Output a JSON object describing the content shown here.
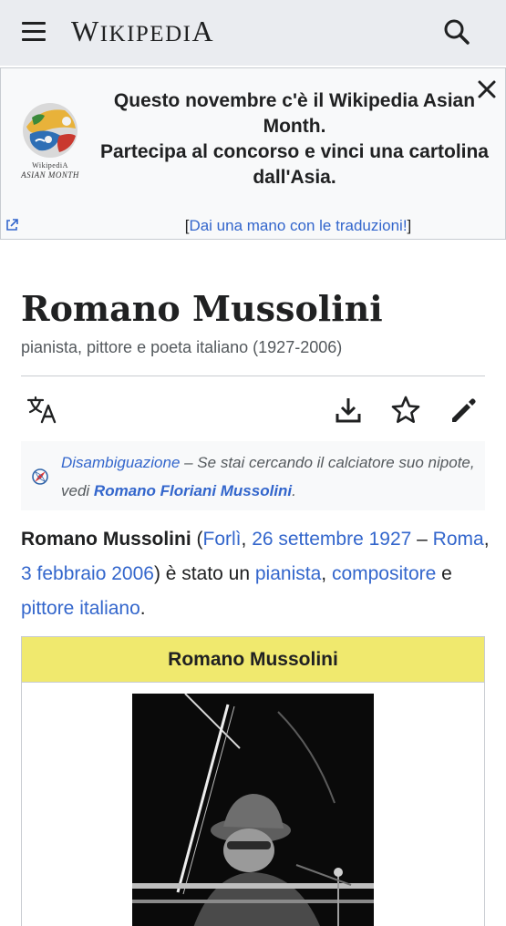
{
  "header": {
    "wordmark_first": "W",
    "wordmark_mid": "IKIPEDI",
    "wordmark_last": "A"
  },
  "banner": {
    "line1": "Questo novembre c'è il Wikipedia Asian Month.",
    "line2": "Partecipa al concorso e vinci una cartolina dall'Asia.",
    "logo_line1": "WikipediA",
    "logo_line2": "ASIAN MONTH",
    "link_open": "[",
    "link_label": "Dai una mano con le traduzioni!",
    "link_close": "]"
  },
  "page": {
    "title": "Romano Mussolini",
    "description": "pianista, pittore e poeta italiano (1927-2006)"
  },
  "hatnote": {
    "link1": "Disambiguazione",
    "text1": " – Se stai cercando il calciatore suo nipote, vedi ",
    "link2": "Romano Floriani Mussolini",
    "text2": "."
  },
  "lead": {
    "subject": "Romano Mussolini",
    "p1": " (",
    "birthplace": "Forlì",
    "p2": ", ",
    "birthdate": "26 settembre 1927",
    "p3": " – ",
    "deathplace": "Roma",
    "p4": ", ",
    "deathdate": "3 febbraio 2006",
    "p5": ") è stato un ",
    "occupation1": "pianista",
    "p6": ", ",
    "occupation2": "compositore",
    "p7": " e ",
    "occupation3": "pittore",
    "p8": " ",
    "nationality": "italiano",
    "p9": "."
  },
  "infobox": {
    "title": "Romano Mussolini",
    "header_color": "#f0e96e"
  },
  "colors": {
    "link": "#3366cc",
    "header_bg": "#eaecf0",
    "banner_bg": "#f8f9fa",
    "text": "#202122",
    "muted": "#54595d"
  },
  "icons": {
    "menu": "hamburger-menu-icon",
    "search": "magnifier-icon",
    "close": "close-x-icon",
    "external": "external-link-icon",
    "translate": "language-translate-icon",
    "download": "download-icon",
    "watch": "star-outline-icon",
    "edit": "pencil-icon",
    "disambiguation": "compass-icon"
  }
}
